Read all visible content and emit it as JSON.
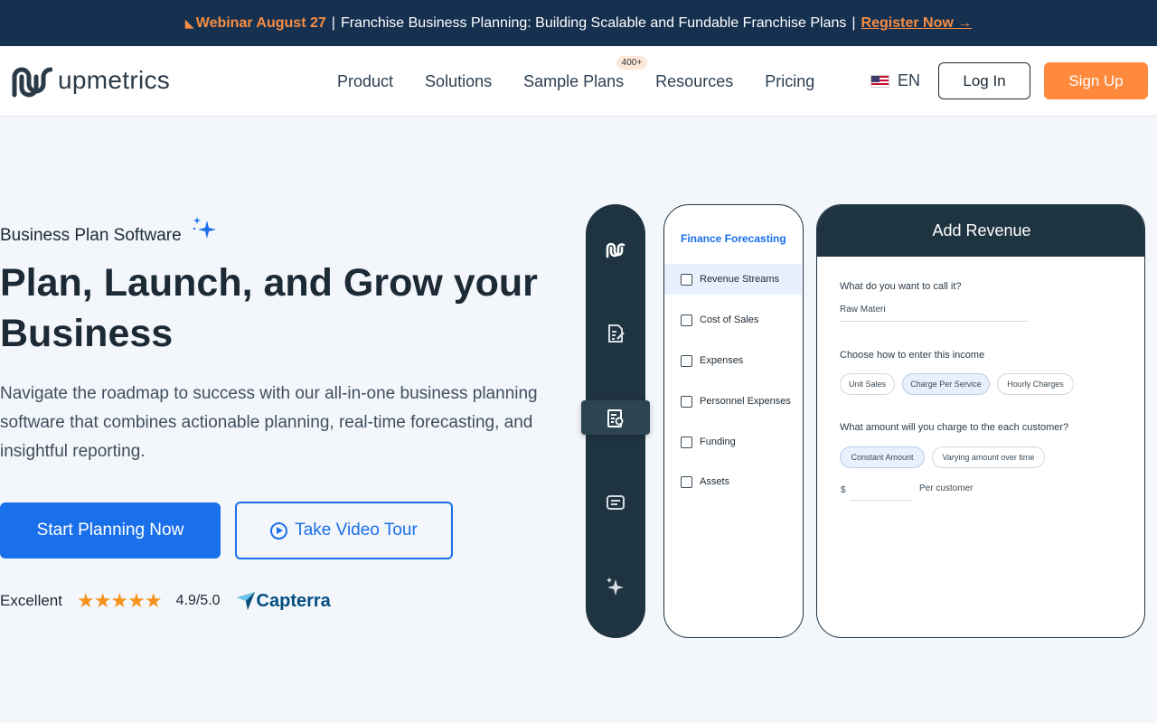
{
  "banner": {
    "webinar_label": "Webinar August 27",
    "separator1": "|",
    "headline": "Franchise Business Planning: Building Scalable and Fundable Franchise Plans",
    "separator2": "|",
    "cta": "Register Now →"
  },
  "header": {
    "logo_text": "upmetrics",
    "nav": [
      {
        "label": "Product"
      },
      {
        "label": "Solutions"
      },
      {
        "label": "Sample Plans",
        "badge": "400+"
      },
      {
        "label": "Resources"
      },
      {
        "label": "Pricing"
      }
    ],
    "language": "EN",
    "login_label": "Log In",
    "signup_label": "Sign Up"
  },
  "hero": {
    "eyebrow": "Business Plan Software",
    "title": "Plan, Launch, and Grow your Business",
    "subtitle": "Navigate the roadmap to success with our all-in-one business planning software that combines actionable planning, real-time forecasting, and insightful reporting.",
    "primary_cta": "Start Planning Now",
    "secondary_cta": "Take Video Tour",
    "rating": {
      "label": "Excellent",
      "stars": "★★★★★",
      "score": "4.9/5.0",
      "source": "Capterra"
    }
  },
  "mockup": {
    "menu": {
      "title": "Finance Forecasting",
      "items": [
        "Revenue Streams",
        "Cost of Sales",
        "Expenses",
        "Personnel Expenses",
        "Funding",
        "Assets"
      ],
      "active_index": 0
    },
    "form": {
      "title": "Add Revenue",
      "q1": "What do you want to call it?",
      "q1_value": "Raw Materi",
      "q2": "Choose how to enter this income",
      "q2_options": [
        "Unit Sales",
        "Charge Per Service",
        "Hourly Charges"
      ],
      "q2_selected": "Charge Per Service",
      "q3": "What amount will you charge to the each customer?",
      "q3_options": [
        "Constant Amount",
        "Varying amount over time"
      ],
      "q3_selected": "Constant Amount",
      "currency": "$",
      "unit": "Per customer"
    }
  },
  "colors": {
    "banner_bg": "#16304f",
    "accent_orange": "#ff8a3d",
    "primary_blue": "#1a6fea",
    "dark_panel": "#1f3441"
  }
}
